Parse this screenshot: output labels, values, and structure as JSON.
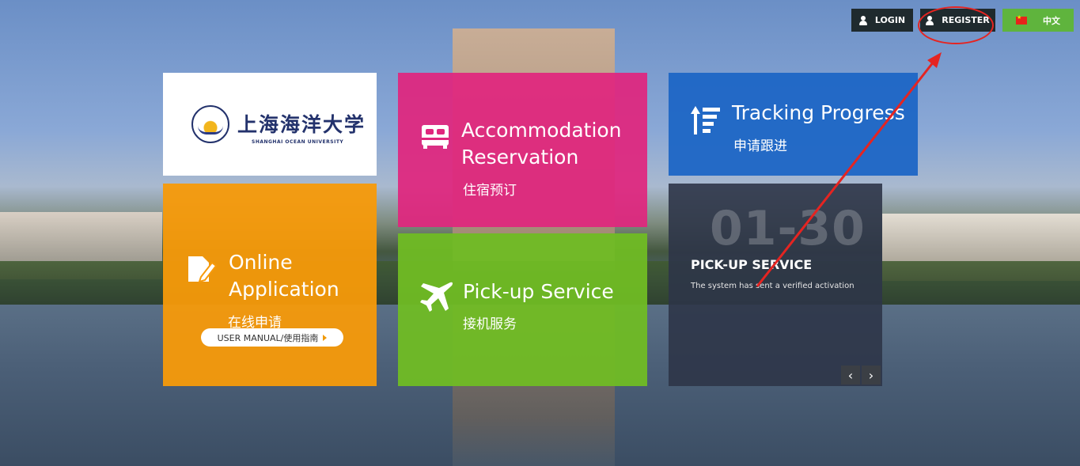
{
  "topbar": {
    "login_label": "LOGIN",
    "register_label": "REGISTER",
    "language_label": "中文"
  },
  "logo": {
    "name_cn": "上海海洋大学",
    "name_en": "SHANGHAI OCEAN UNIVERSITY"
  },
  "tiles": {
    "accommodation": {
      "title_line1": "Accommodation",
      "title_line2": "Reservation",
      "subtitle": "住宿预订",
      "icon": "bed-icon"
    },
    "tracking": {
      "title": "Tracking Progress",
      "subtitle": "申请跟进",
      "icon": "sort-list-icon"
    },
    "online": {
      "title_line1": "Online",
      "title_line2": "Application",
      "subtitle": "在线申请",
      "manual_label": "USER MANUAL/使用指南",
      "icon": "edit-document-icon"
    },
    "pickup": {
      "title": "Pick-up Service",
      "subtitle": "接机服务",
      "icon": "airplane-icon"
    },
    "news": {
      "date": "01-30",
      "title": "PICK-UP SERVICE",
      "text": "The system has sent a verified activation",
      "prev": "‹",
      "next": "›"
    }
  },
  "colors": {
    "accommodation": "#e0267e",
    "tracking": "#1e66c5",
    "online": "#f79a0a",
    "pickup": "#70bc24",
    "news": "#2d3548",
    "annotation": "#e52421"
  }
}
